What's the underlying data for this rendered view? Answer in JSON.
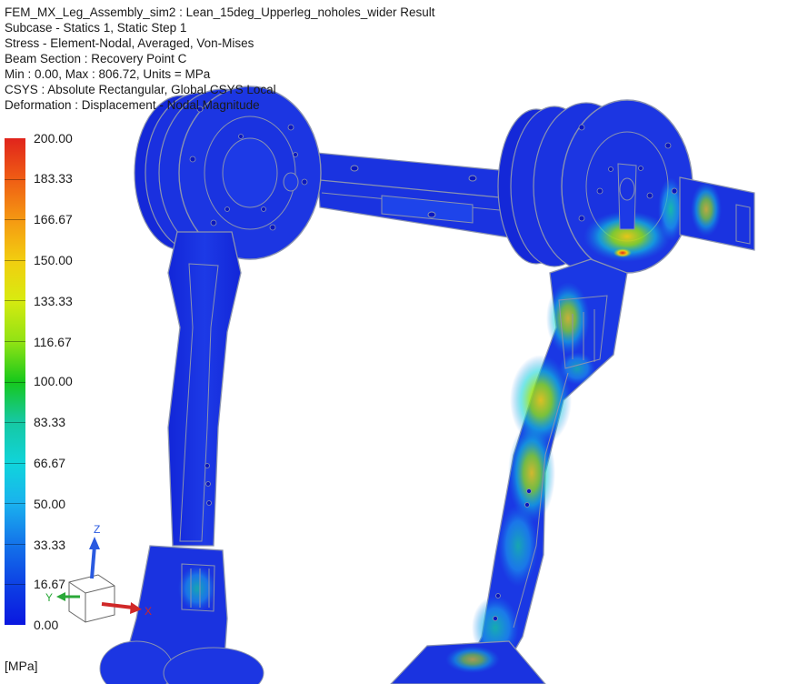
{
  "header": {
    "line1": "FEM_MX_Leg_Assembly_sim2 : Lean_15deg_Upperleg_noholes_wider Result",
    "line2": "Subcase - Statics 1, Static Step 1",
    "line3": "Stress - Element-Nodal, Averaged, Von-Mises",
    "line4": "Beam Section : Recovery Point C",
    "line5": "Min : 0.00, Max : 806.72, Units = MPa",
    "line6": "CSYS : Absolute Rectangular, Global CSYS Local",
    "line7": "Deformation : Displacement - Nodal Magnitude"
  },
  "legend": {
    "labels": [
      "200.00",
      "183.33",
      "166.67",
      "150.00",
      "133.33",
      "116.67",
      "100.00",
      "83.33",
      "66.67",
      "50.00",
      "33.33",
      "16.67",
      "0.00"
    ],
    "units": "[MPa]"
  },
  "triad": {
    "x": "X",
    "y": "Y",
    "z": "Z"
  },
  "colors": {
    "background": "#ffffff",
    "part_base": "#1a2fe0",
    "edge": "#8a93b0",
    "hot_red": "#e0241c",
    "hot_yellow": "#f2cd10",
    "mid_green": "#16c81b",
    "mid_cyan": "#10d4dc"
  }
}
